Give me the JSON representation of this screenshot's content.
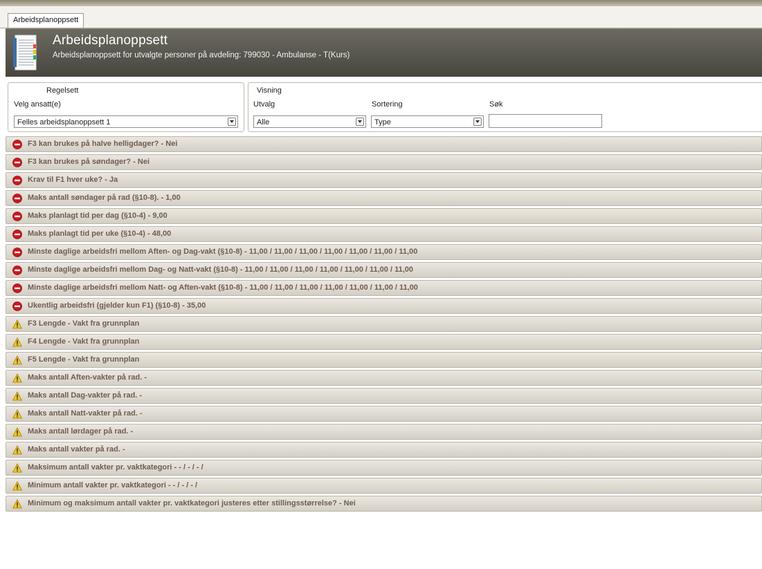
{
  "tab": {
    "label": "Arbeidsplanoppsett"
  },
  "header": {
    "title": "Arbeidsplanoppsett",
    "subtitle": "Arbeidsplanoppsett for utvalgte personer på avdeling: 799030 - Ambulanse - T(Kurs)"
  },
  "regelsett": {
    "title": "Regelsett",
    "employee_label": "Velg ansatt(e)",
    "employee_value": "Felles arbeidsplanoppsett 1"
  },
  "visning": {
    "title": "Visning",
    "utvalg_label": "Utvalg",
    "utvalg_value": "Alle",
    "sortering_label": "Sortering",
    "sortering_value": "Type",
    "sok_label": "Søk",
    "sok_value": ""
  },
  "colors": {
    "error": "#c8191e",
    "warning": "#f2c81c",
    "rule_text": "#6e5d53",
    "header_bg": "#55534a"
  },
  "rules": [
    {
      "type": "error",
      "icon": "error-icon",
      "text": "F3 kan brukes på halve helligdager? - Nei"
    },
    {
      "type": "error",
      "icon": "error-icon",
      "text": "F3 kan brukes på søndager? - Nei"
    },
    {
      "type": "error",
      "icon": "error-icon",
      "text": "Krav til F1 hver uke? - Ja"
    },
    {
      "type": "error",
      "icon": "error-icon",
      "text": "Maks antall søndager på rad (§10-8). - 1,00"
    },
    {
      "type": "error",
      "icon": "error-icon",
      "text": "Maks planlagt tid per dag (§10-4) - 9,00"
    },
    {
      "type": "error",
      "icon": "error-icon",
      "text": "Maks planlagt tid per uke (§10-4) - 48,00"
    },
    {
      "type": "error",
      "icon": "error-icon",
      "text": "Minste daglige arbeidsfri mellom Aften- og Dag-vakt (§10-8) - 11,00 / 11,00 / 11,00 / 11,00 / 11,00 / 11,00 / 11,00"
    },
    {
      "type": "error",
      "icon": "error-icon",
      "text": "Minste daglige arbeidsfri mellom Dag- og Natt-vakt (§10-8) - 11,00 / 11,00 / 11,00 / 11,00 / 11,00 / 11,00 / 11,00"
    },
    {
      "type": "error",
      "icon": "error-icon",
      "text": "Minste daglige arbeidsfri mellom Natt- og Aften-vakt (§10-8) - 11,00 / 11,00 / 11,00 / 11,00 / 11,00 / 11,00 / 11,00"
    },
    {
      "type": "error",
      "icon": "error-icon",
      "text": "Ukentlig arbeidsfri (gjelder kun F1) (§10-8) - 35,00"
    },
    {
      "type": "warning",
      "icon": "warning-icon",
      "text": "F3 Lengde - Vakt fra grunnplan"
    },
    {
      "type": "warning",
      "icon": "warning-icon",
      "text": "F4 Lengde - Vakt fra grunnplan"
    },
    {
      "type": "warning",
      "icon": "warning-icon",
      "text": "F5 Lengde - Vakt fra grunnplan"
    },
    {
      "type": "warning",
      "icon": "warning-icon",
      "text": "Maks antall Aften-vakter på rad. -"
    },
    {
      "type": "warning",
      "icon": "warning-icon",
      "text": "Maks antall Dag-vakter på rad. -"
    },
    {
      "type": "warning",
      "icon": "warning-icon",
      "text": "Maks antall Natt-vakter på rad. -"
    },
    {
      "type": "warning",
      "icon": "warning-icon",
      "text": "Maks antall lørdager på rad. -"
    },
    {
      "type": "warning",
      "icon": "warning-icon",
      "text": "Maks antall vakter på rad. -"
    },
    {
      "type": "warning",
      "icon": "warning-icon",
      "text": "Maksimum antall vakter pr. vaktkategori - - / - / - /"
    },
    {
      "type": "warning",
      "icon": "warning-icon",
      "text": "Minimum antall vakter pr. vaktkategori - - / - / - /"
    },
    {
      "type": "warning",
      "icon": "warning-icon",
      "text": "Minimum og maksimum antall vakter pr. vaktkategori justeres etter stillingsstørrelse? - Nei"
    }
  ]
}
